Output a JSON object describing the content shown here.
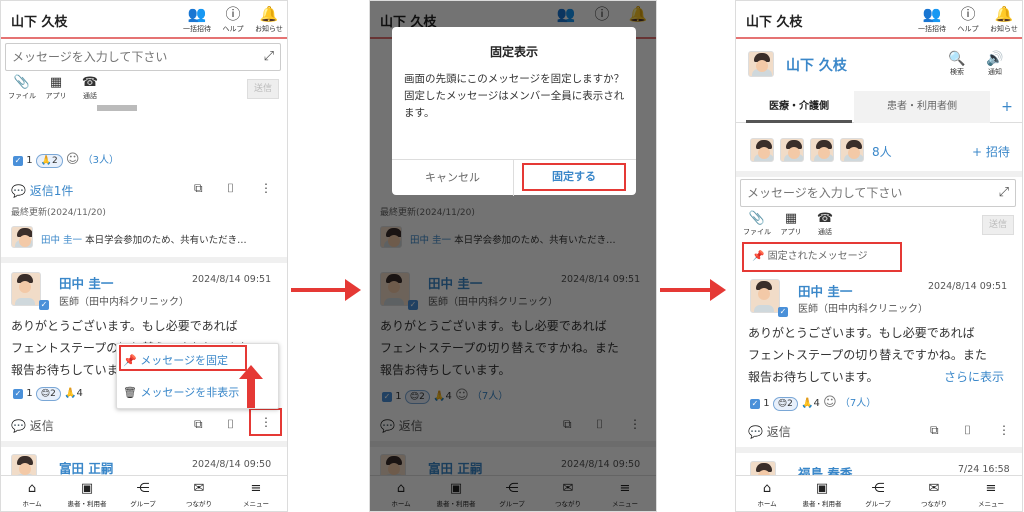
{
  "header": {
    "user_name": "山下 久枝",
    "invite_label": "一括招待",
    "help_label": "ヘルプ",
    "notice_label": "お知らせ",
    "search_label": "検索",
    "notify_label": "通知"
  },
  "composer": {
    "placeholder": "メッセージを入力して下さい",
    "file_label": "ファイル",
    "app_label": "アプリ",
    "call_label": "通話",
    "send_label": "送信"
  },
  "thread_prev": {
    "reaction_check_count": "1",
    "reaction_pray_count": "2",
    "reaction_people": "（3人）",
    "reply_link": "返信1件",
    "last_updated": "最終更新(2024/11/20)",
    "reply_preview_name": "田中 圭一",
    "reply_preview_text": "本日学会参加のため、共有いただき…"
  },
  "message": {
    "author": "田中 圭一",
    "date": "2024/8/14 09:51",
    "role": "医師（田中内科クリニック）",
    "body_line1": "ありがとうございます。もし必要であれば",
    "body_line2": "フェントステープの切り替えですかね。また",
    "body_line3": "報告お待ちしています。",
    "reaction_check_count": "1",
    "reaction_face_count": "2",
    "reaction_pray_count": "4",
    "reaction_people": "（7人）",
    "reply_label": "返信",
    "more_label": "さらに表示"
  },
  "next_message": {
    "author_p1": "富田 正嗣",
    "date_p1": "2024/8/14 09:50",
    "author_p3": "福島 春香",
    "date_p3": "7/24 16:58"
  },
  "context_menu": {
    "pin_label": "メッセージを固定",
    "hide_label": "メッセージを非表示"
  },
  "dialog": {
    "title": "固定表示",
    "message": "画面の先頭にこのメッセージを固定しますか？\n固定したメッセージはメンバー全員に表示されます。",
    "cancel_label": "キャンセル",
    "ok_label": "固定する"
  },
  "group": {
    "name": "山下 久枝",
    "tab_medical": "医療・介護側",
    "tab_patient": "患者・利用者側",
    "tab_add": "+",
    "member_count": "8人",
    "invite_link": "+ 招待",
    "pinned_label": "固定されたメッセージ"
  },
  "nav": {
    "home": "ホーム",
    "patients": "患者・利用者",
    "group": "グループ",
    "connect": "つながり",
    "menu": "メニュー"
  },
  "colors": {
    "accent_red": "#e53935",
    "link_blue": "#3a87c9",
    "header_line": "#e57373"
  }
}
